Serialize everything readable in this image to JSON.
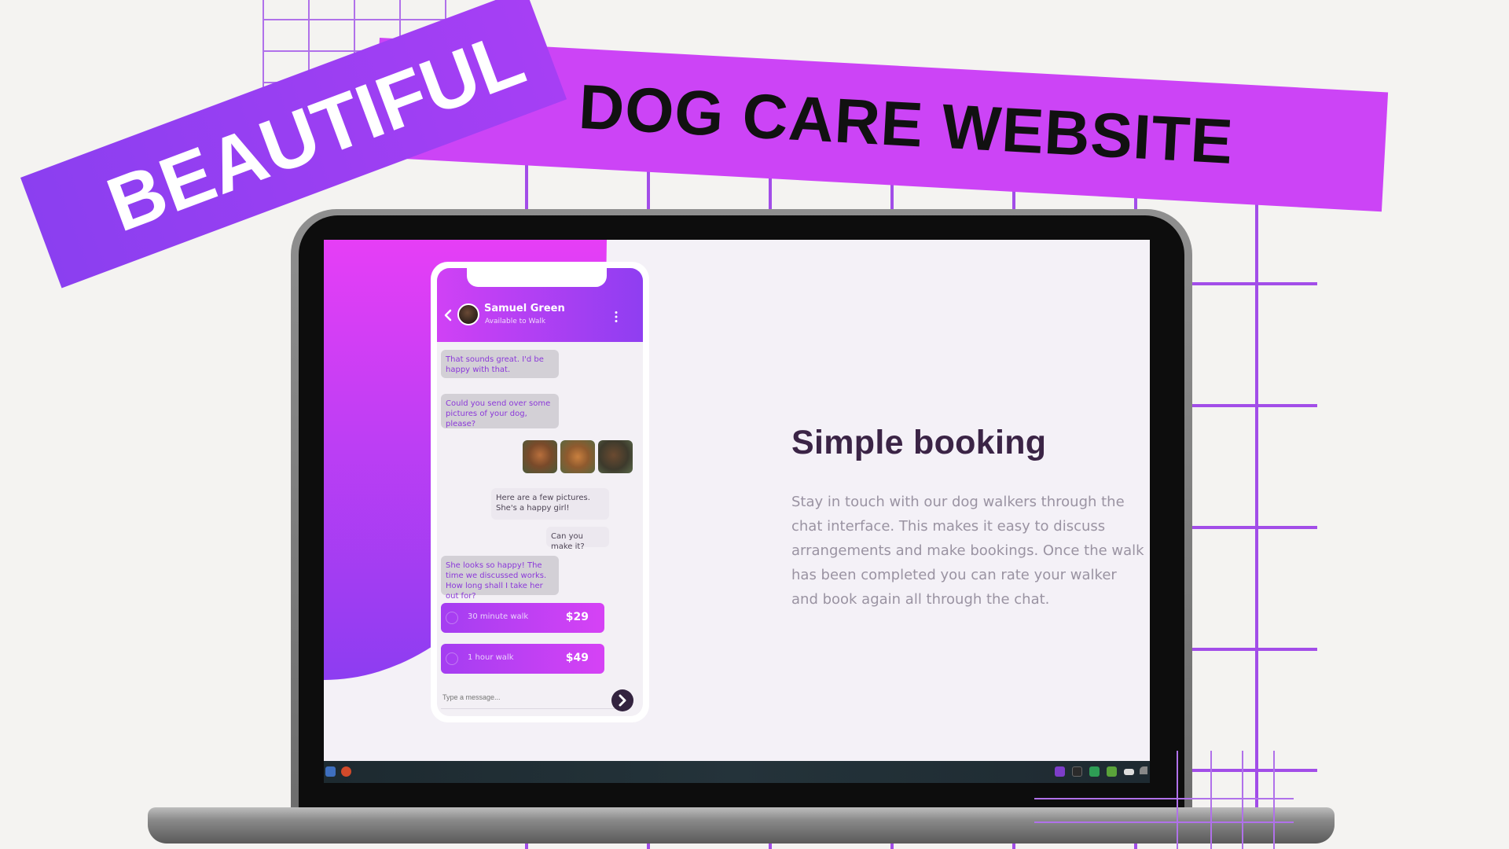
{
  "banners": {
    "top": "DOG CARE WEBSITE",
    "angled": "BEAUTIFUL"
  },
  "colors": {
    "accent_purple": "#cc44f6",
    "deep_purple": "#8d3df1",
    "grid_purple": "#a24de8",
    "heading_dark": "#3b2446"
  },
  "chat": {
    "contact_name": "Samuel Green",
    "contact_status": "Available to Walk",
    "messages": {
      "m1": "That sounds great. I'd be happy with that.",
      "m2": "Could you send over some pictures of your dog, please?",
      "m3": "Here are a few pictures. She's a happy girl!",
      "m4": "Can you make it?",
      "m5": "She looks so happy! The time we discussed works. How long shall I take her out for?"
    },
    "options": [
      {
        "label": "30 minute walk",
        "price": "$29"
      },
      {
        "label": "1 hour walk",
        "price": "$49"
      }
    ],
    "input_placeholder": "Type a message..."
  },
  "feature": {
    "title": "Simple booking",
    "description": "Stay in touch with our dog walkers through the chat interface. This makes it easy to discuss arrangements and make bookings. Once the walk has been completed you can rate your walker and book again all through the chat."
  },
  "icons": [
    "back-arrow-icon",
    "more-vertical-icon",
    "send-arrow-icon",
    "radio-circle-icon",
    "taskbar-app-icon"
  ]
}
